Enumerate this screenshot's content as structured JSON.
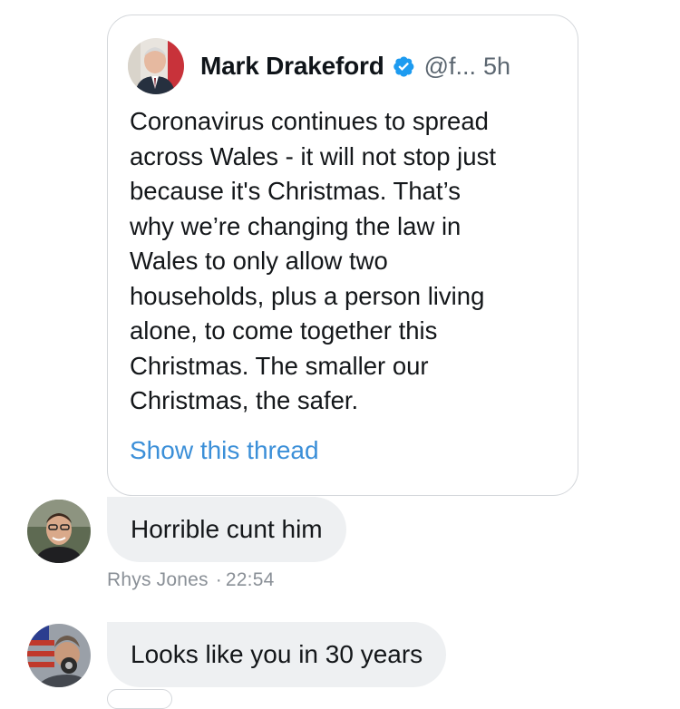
{
  "quoted_tweet": {
    "author_name": "Mark Drakeford",
    "handle": "@f...",
    "time": "5h",
    "body_lines": [
      "Coronavirus continues to spread",
      "across Wales - it will not stop just",
      "because it's Christmas. That’s",
      "why we’re changing the law in",
      "Wales to only allow two",
      "households, plus a person living",
      "alone, to come together this",
      "Christmas. The smaller our",
      "Christmas, the safer."
    ],
    "show_thread_label": "Show this thread",
    "verified_color": "#1d9bf0",
    "link_color": "#3b8fd8"
  },
  "comments": [
    {
      "text": "Horrible cunt him",
      "author": "Rhys Jones",
      "time": "22:54"
    },
    {
      "text": "Looks like you in 30 years"
    }
  ],
  "icons": {
    "verified": "verified-badge-icon",
    "avatars": [
      "author-avatar",
      "commenter-avatar"
    ]
  }
}
